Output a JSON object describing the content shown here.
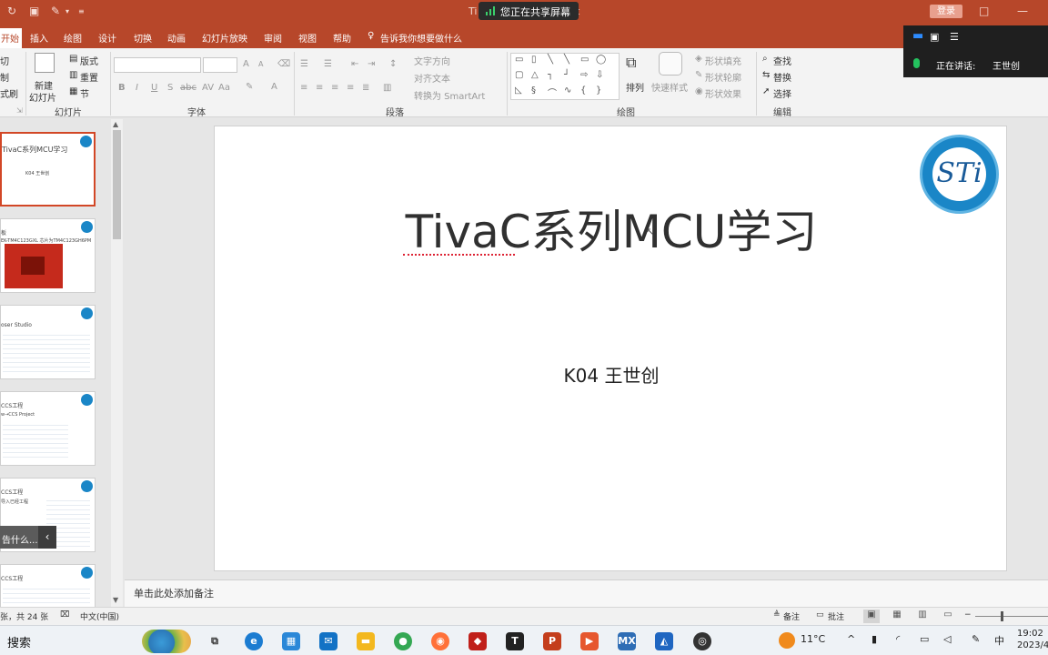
{
  "titlebar": {
    "title_left": "Ti",
    "title_right": "nt",
    "share_label": "您正在共享屏幕",
    "login_label": "登录"
  },
  "menu": {
    "tabs": [
      "开始",
      "插入",
      "绘图",
      "设计",
      "切换",
      "动画",
      "幻灯片放映",
      "审阅",
      "视图",
      "帮助"
    ],
    "tell_me": "告诉我你想要做什么"
  },
  "ribbon": {
    "slides_group": {
      "label": "幻灯片",
      "new_slide": "新建",
      "new_slide2": "幻灯片",
      "layout": "版式",
      "reset": "重置",
      "section": "节",
      "cut": "切",
      "copy": "制",
      "painter": "式刷"
    },
    "font_group": {
      "label": "字体",
      "bold": "B",
      "italic": "I",
      "underline": "U",
      "strike": "S",
      "shadow": "abc",
      "spacing": "AV",
      "case": "Aa",
      "color": "A",
      "grow": "A",
      "shrink": "A"
    },
    "paragraph_group": {
      "label": "段落",
      "text_direction": "文字方向",
      "align_text": "对齐文本",
      "smartart": "转换为 SmartArt"
    },
    "drawing_group": {
      "label": "绘图",
      "arrange": "排列",
      "quick_styles": "快速样式",
      "shape_fill": "形状填充",
      "shape_outline": "形状轮廓",
      "shape_effects": "形状效果"
    },
    "editing_group": {
      "label": "编辑",
      "find": "查找",
      "replace": "替换",
      "select": "选择"
    }
  },
  "zoom_overlay": {
    "speaking_label": "正在讲话:",
    "speaker": "王世创"
  },
  "thumbnails": [
    {
      "text": "TivaC系列MCU学习",
      "sub": "K04 王世创",
      "selected": true
    },
    {
      "text": "板",
      "sub": "EK-TM4C123GXL 芯片为TM4C123GH6PM",
      "selected": false
    },
    {
      "text": "oser Studio",
      "sub": "",
      "selected": false
    },
    {
      "text": "CCS工程",
      "sub": "w→CCS Project",
      "selected": false
    },
    {
      "text": "CCS工程",
      "sub": "导入已经工程",
      "selected": false
    },
    {
      "text": "CCS工程",
      "sub": "",
      "selected": false
    }
  ],
  "popup": {
    "text": "告什么..."
  },
  "slide": {
    "title": "TivaC系列MCU学习",
    "subtitle": "K04 王世创",
    "logo_text": "STi"
  },
  "notes": {
    "placeholder": "单击此处添加备注"
  },
  "status": {
    "slide_count": "张，共 24 张",
    "language": "中文(中国)",
    "notes_btn": "备注",
    "comments_btn": "批注"
  },
  "taskbar": {
    "search": "搜索",
    "weather": "11°C",
    "ime": "中",
    "time": "19:02",
    "date": "2023/4/"
  }
}
